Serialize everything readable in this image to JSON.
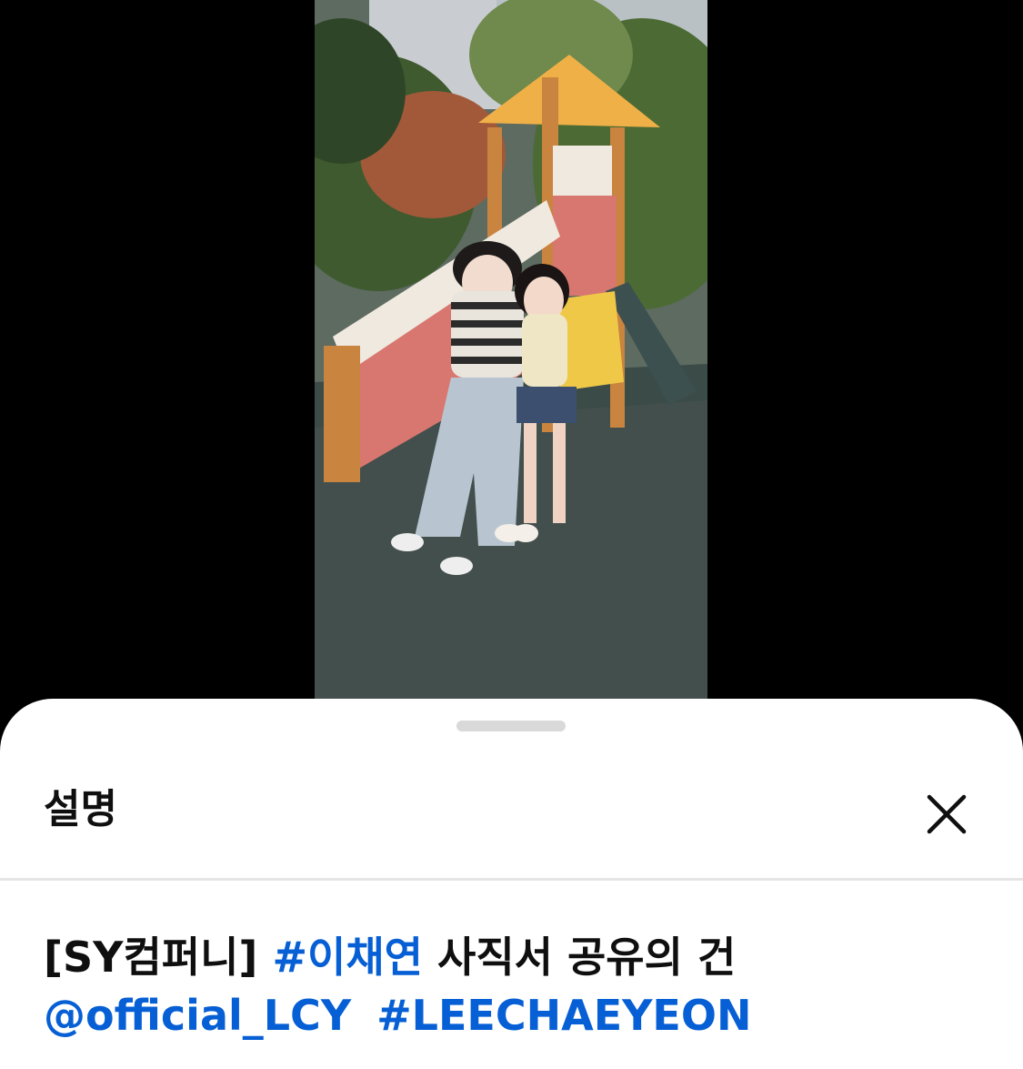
{
  "sheet": {
    "title": "설명",
    "close_icon": "close-icon"
  },
  "description": {
    "prefix": "[SY컴퍼니]",
    "hashtag_1": "#이채연",
    "suffix": "사직서 공유의 건",
    "mention": "@official_LCY",
    "hashtag_2": "#LEECHAEYEON"
  },
  "colors": {
    "link": "#065fd4",
    "text": "#0f0f0f",
    "background": "#000000",
    "sheet": "#ffffff"
  }
}
